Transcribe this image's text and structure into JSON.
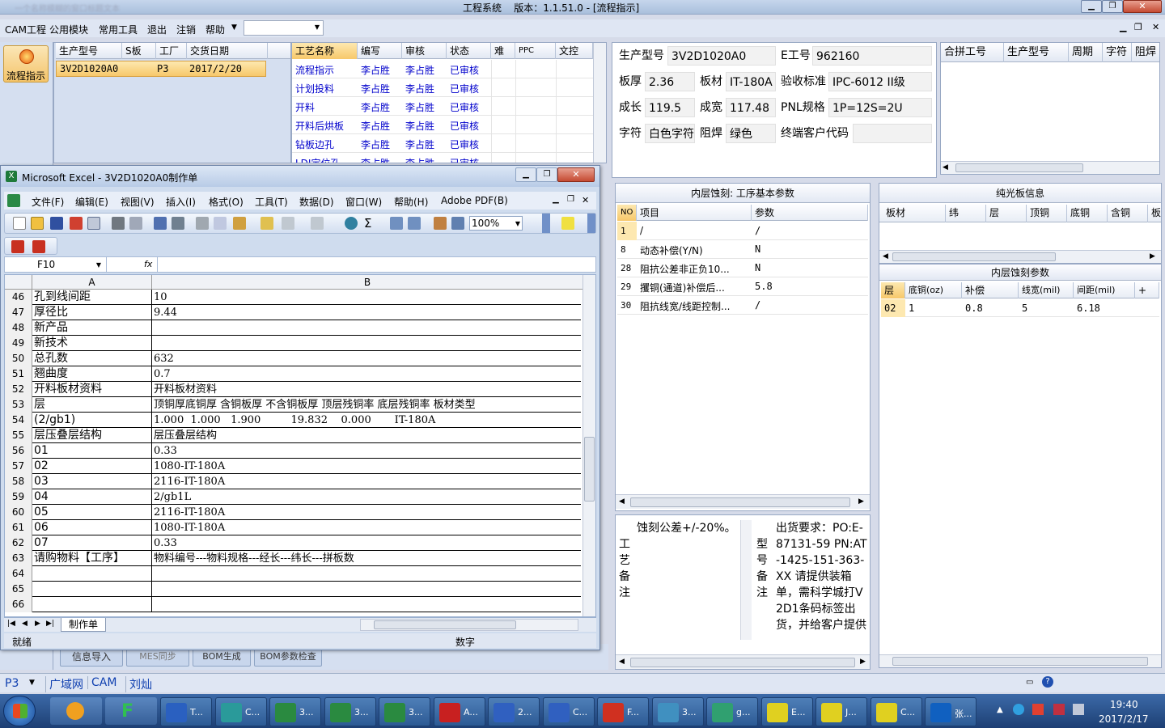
{
  "app": {
    "title": "工程系统    版本：1.1.51.0 - [流程指示]",
    "title_left_blur": "一个名称模糊的窗口标题文本"
  },
  "menubar": [
    "CAM工程",
    "公用模块",
    "常用工具",
    "退出",
    "注销",
    "帮助"
  ],
  "left_nav": {
    "button_label": "流程指示"
  },
  "orders": {
    "headers": [
      "生产型号",
      "S板",
      "工厂",
      "交货日期"
    ],
    "rows": [
      [
        "3V2D1020A0",
        "",
        "P3",
        "2017/2/20"
      ]
    ]
  },
  "process": {
    "headers": [
      "工艺名称",
      "编写",
      "审核",
      "状态",
      "难",
      "PPC",
      "文控"
    ],
    "rows": [
      [
        "流程指示",
        "李占胜",
        "李占胜",
        "已审核"
      ],
      [
        "计划投料",
        "李占胜",
        "李占胜",
        "已审核"
      ],
      [
        "开料",
        "李占胜",
        "李占胜",
        "已审核"
      ],
      [
        "开料后烘板",
        "李占胜",
        "李占胜",
        "已审核"
      ],
      [
        "钻板边孔",
        "李占胜",
        "李占胜",
        "已审核"
      ],
      [
        "LDI定位孔",
        "李占胜",
        "李占胜",
        "已审核"
      ]
    ]
  },
  "bottom_buttons": [
    "信息导入",
    "MES同步",
    "BOM生成",
    "BOM参数检查"
  ],
  "info": {
    "labels": [
      "生产型号",
      "E工号",
      "板厚",
      "板材",
      "验收标准",
      "成长",
      "成宽",
      "PNL规格",
      "字符",
      "阻焊",
      "终端客户代码"
    ],
    "prod_no": "3V2D1020A0",
    "e_no": "962160",
    "thickness": "2.36",
    "material": "IT-180A",
    "standard": "IPC-6012 II级",
    "length": "119.5",
    "width": "117.48",
    "pnl": "1P=12S=2U",
    "char": "白色字符",
    "mask": "绿色",
    "client_code": ""
  },
  "merge_table": {
    "headers": [
      "合拼工号",
      "生产型号",
      "周期",
      "字符",
      "阻焊"
    ]
  },
  "etch": {
    "title": "内层蚀刻: 工序基本参数",
    "headers": [
      "NO",
      "项目",
      "参数"
    ],
    "rows": [
      [
        "1",
        "/",
        "/"
      ],
      [
        "8",
        "动态补偿(Y/N)",
        "N"
      ],
      [
        "28",
        "阻抗公差非正负10...",
        "N"
      ],
      [
        "29",
        "攫铜(通道)补偿后...",
        "5.8"
      ],
      [
        "30",
        "阻抗线宽/线距控制...",
        "/"
      ]
    ]
  },
  "bare_board": {
    "title": "纯光板信息",
    "headers": [
      "板材",
      "纬",
      "层",
      "顶铜",
      "底铜",
      "含铜",
      "板"
    ]
  },
  "inner_etch": {
    "title": "内层蚀刻参数",
    "headers": [
      "层",
      "底铜(oz)",
      "补偿",
      "线宽(mil)",
      "间距(mil)",
      "+"
    ],
    "rows": [
      [
        "02",
        "1",
        "0.8",
        "5",
        "6.18"
      ]
    ]
  },
  "notes": {
    "process_label": "工艺备注",
    "process_text": "蚀刻公差+/-20%。",
    "model_label": "型号备注",
    "model_text": "出货要求：PO:E-87131-59 PN:AT-1425-151-363-XX 请提供装箱单，需科学城打V2D1条码标签出货，并给客户提供"
  },
  "statusbar": {
    "factory": "P3",
    "items": [
      "广域网",
      "CAM",
      "刘灿"
    ]
  },
  "excel": {
    "title": "Microsoft Excel - 3V2D1020A0制作单",
    "menu": [
      "文件(F)",
      "编辑(E)",
      "视图(V)",
      "插入(I)",
      "格式(O)",
      "工具(T)",
      "数据(D)",
      "窗口(W)",
      "帮助(H)",
      "Adobe PDF(B)"
    ],
    "zoom": "100%",
    "namebox": "F10",
    "fx": "fx",
    "col_a": "A",
    "col_b": "B",
    "rows": [
      [
        "46",
        "孔到线间距",
        "10"
      ],
      [
        "47",
        "厚径比",
        "9.44"
      ],
      [
        "48",
        "新产品",
        ""
      ],
      [
        "49",
        "新技术",
        ""
      ],
      [
        "50",
        "总孔数",
        "632"
      ],
      [
        "51",
        "翘曲度",
        "0.7"
      ],
      [
        "52",
        "开料板材资料",
        "开料板材资料"
      ],
      [
        "53",
        "层",
        "顶铜厚底铜厚 含铜板厚 不含铜板厚 顶层残铜率 底层残铜率 板材类型"
      ],
      [
        "54",
        "(2/gb1)",
        "1.000  1.000   1.900         19.832    0.000       IT-180A"
      ],
      [
        "55",
        "层压叠层结构",
        "层压叠层结构"
      ],
      [
        "56",
        "01",
        "0.33"
      ],
      [
        "57",
        "02",
        "1080-IT-180A"
      ],
      [
        "58",
        "03",
        "2116-IT-180A"
      ],
      [
        "59",
        "04",
        "2/gb1L"
      ],
      [
        "60",
        "05",
        "2116-IT-180A"
      ],
      [
        "61",
        "06",
        "1080-IT-180A"
      ],
      [
        "62",
        "07",
        "0.33"
      ],
      [
        "63",
        "请购物料【工序】",
        "物料编号---物料规格---经长---纬长---拼板数"
      ],
      [
        "64",
        "",
        ""
      ],
      [
        "65",
        "",
        ""
      ],
      [
        "66",
        "",
        ""
      ]
    ],
    "sheet_tab": "制作单",
    "status": "就绪",
    "status_num": "数字"
  },
  "taskbar": {
    "buttons": [
      "T...",
      "C...",
      "3...",
      "3...",
      "3...",
      "A...",
      "2...",
      "C...",
      "F...",
      "3...",
      "g...",
      "E...",
      "J...",
      "C...",
      "张..."
    ],
    "time": "19:40",
    "date": "2017/2/17"
  }
}
